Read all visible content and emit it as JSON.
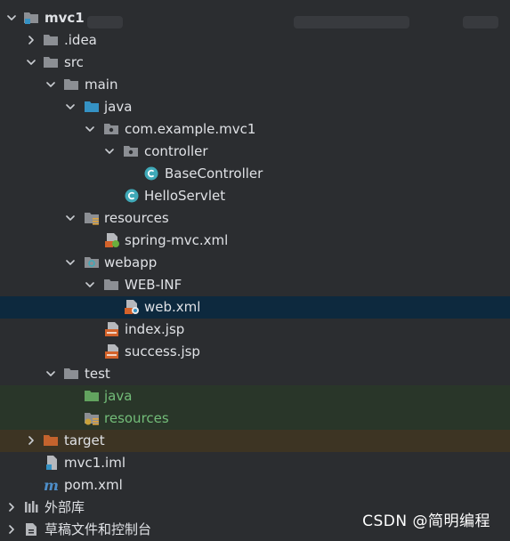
{
  "tree": {
    "project": {
      "label": "mvc1"
    },
    "idea": {
      "label": ".idea"
    },
    "src": {
      "label": "src"
    },
    "main": {
      "label": "main"
    },
    "java": {
      "label": "java"
    },
    "package": {
      "label": "com.example.mvc1"
    },
    "controller": {
      "label": "controller"
    },
    "base_controller": {
      "label": "BaseController"
    },
    "hello_servlet": {
      "label": "HelloServlet"
    },
    "resources": {
      "label": "resources"
    },
    "spring_mvc_xml": {
      "label": "spring-mvc.xml"
    },
    "webapp": {
      "label": "webapp"
    },
    "web_inf": {
      "label": "WEB-INF"
    },
    "web_xml": {
      "label": "web.xml"
    },
    "index_jsp": {
      "label": "index.jsp"
    },
    "success_jsp": {
      "label": "success.jsp"
    },
    "test": {
      "label": "test"
    },
    "test_java": {
      "label": "java"
    },
    "test_resources": {
      "label": "resources"
    },
    "target": {
      "label": "target"
    },
    "mvc1_iml": {
      "label": "mvc1.iml"
    },
    "pom_xml": {
      "label": "pom.xml"
    },
    "external_libs": {
      "label": "外部库"
    },
    "scratches": {
      "label": "草稿文件和控制台"
    }
  },
  "watermark": {
    "text": "CSDN @简明编程"
  },
  "colors": {
    "background": "#2b2d30",
    "selected_row": "#0d293e",
    "test_highlight": "#293629",
    "excluded_highlight": "#3d3423",
    "folder_gray": "#8c8f94",
    "source_blue": "#3592c4",
    "class_teal": "#3fa9b8",
    "jsp_orange": "#d3622a"
  }
}
